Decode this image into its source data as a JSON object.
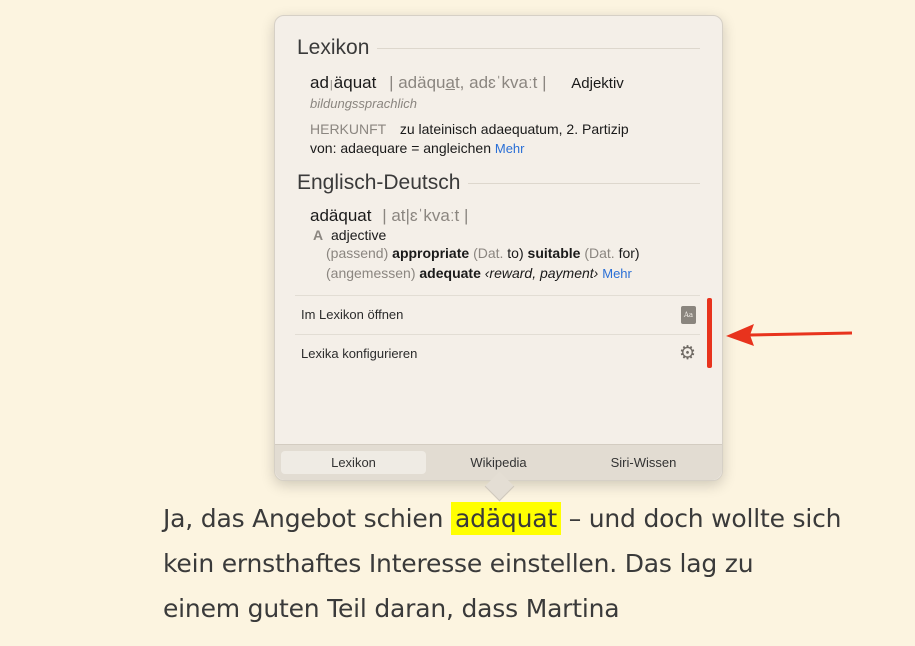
{
  "lexikon": {
    "title": "Lexikon",
    "word_part1": "ad",
    "syllable_sep": "|",
    "word_part2": "äquat",
    "pron_pre": "| adäqu",
    "pron_u": "a",
    "pron_post": "t, adɛˈkvaːt |",
    "pos": "Adjektiv",
    "register": "bildungssprachlich",
    "etym_label": "HERKUNFT",
    "etym_line1": "zu lateinisch adaequatum, 2. Partizip",
    "etym_line2": "von: adaequare = angleichen",
    "more": "Mehr"
  },
  "englisch": {
    "title": "Englisch-Deutsch",
    "word": "adäquat",
    "pron": "| at|ɛˈkvaːt |",
    "pos_letter": "A",
    "pos": "adjective",
    "line1": {
      "ctx": "(passend)",
      "w1": "appropriate",
      "g1": "(Dat.",
      "p1": "to)",
      "w2": "suitable",
      "g2": "(Dat.",
      "p2": "for)"
    },
    "line2": {
      "ctx": "(angemessen)",
      "w1": "adequate",
      "note": "‹reward, payment›",
      "more": "Mehr"
    }
  },
  "actions": {
    "open": "Im Lexikon öffnen",
    "configure": "Lexika konfigurieren",
    "book_icon_text": "Aa"
  },
  "tabs": [
    "Lexikon",
    "Wikipedia",
    "Siri-Wissen"
  ],
  "text": {
    "line1_pre": "Ja, das Angebot schien ",
    "line1_hl": "adäquat",
    "line1_post": " – und doch wollte sich",
    "line2": "kein ernsthaftes Interesse einstellen. Das lag zu",
    "line3": "einem guten Teil daran, dass Martina"
  },
  "colors": {
    "highlight": "#ffff00",
    "annotation": "#e8331d",
    "link": "#2a6fd6"
  }
}
